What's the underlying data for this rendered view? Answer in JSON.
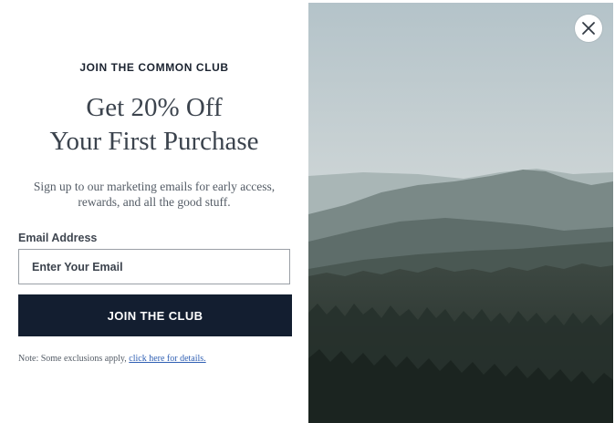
{
  "popup": {
    "eyebrow": "JOIN THE COMMON CLUB",
    "headline_line1": "Get 20% Off",
    "headline_line2": "Your First Purchase",
    "subtext": "Sign up to our marketing emails for early access, rewards, and all the good stuff.",
    "email_label": "Email Address",
    "email_placeholder": "Enter Your Email",
    "email_value": "",
    "cta_label": "JOIN THE CLUB",
    "note_prefix": "Note: Some exclusions apply,",
    "note_link": "click here for details."
  },
  "icons": {
    "close": "close-icon",
    "image": "mountain-forest-image"
  },
  "colors": {
    "cta_background": "#131e30",
    "link": "#2f5fb3",
    "heading": "#3b434d"
  }
}
